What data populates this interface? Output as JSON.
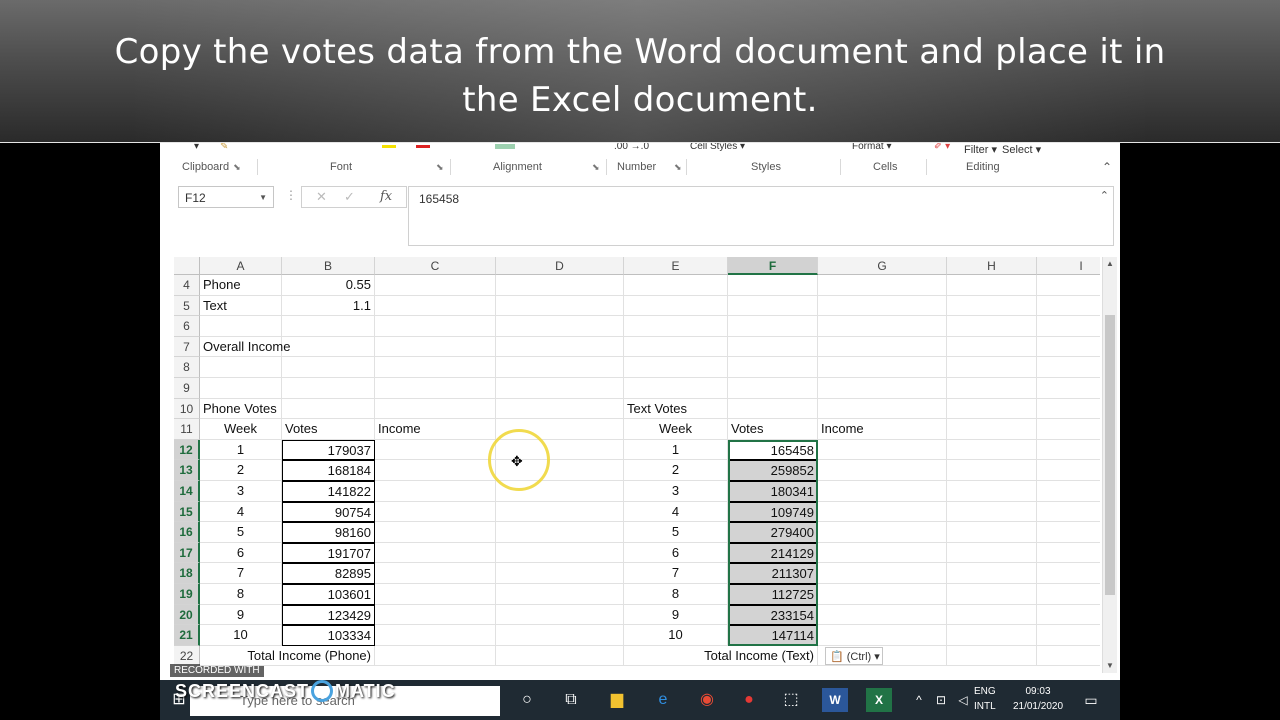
{
  "caption": {
    "line1": "Copy the votes data from the Word document and place it in",
    "line2": "the Excel document."
  },
  "ribbon": {
    "top_items": {
      "number_format": ".00 →.0",
      "cell_styles": "Cell Styles ▾",
      "format": "Format ▾",
      "filter": "Filter ▾",
      "select": "Select ▾"
    },
    "groups": [
      "Clipboard",
      "Font",
      "Alignment",
      "Number",
      "Styles",
      "Cells",
      "Editing"
    ]
  },
  "formula": {
    "namebox": "F12",
    "value": "165458"
  },
  "columns": [
    "A",
    "B",
    "C",
    "D",
    "E",
    "F",
    "G",
    "H",
    "I"
  ],
  "selected_column": "F",
  "rows": {
    "r4": {
      "num": "4",
      "a": "Phone",
      "b": "0.55"
    },
    "r5": {
      "num": "5",
      "a": "Text",
      "b": "1.1"
    },
    "r6": {
      "num": "6"
    },
    "r7": {
      "num": "7",
      "a": "Overall Income"
    },
    "r8": {
      "num": "8"
    },
    "r9": {
      "num": "9"
    },
    "r10": {
      "num": "10",
      "a": "Phone Votes",
      "e": "Text Votes"
    },
    "r11": {
      "num": "11",
      "a": "Week",
      "b": "Votes",
      "c": "Income",
      "e": "Week",
      "f": "Votes",
      "g": "Income"
    },
    "r22": {
      "num": "22",
      "ab": "Total Income (Phone)",
      "ef": "Total Income (Text)"
    }
  },
  "phone_votes": [
    {
      "row": "12",
      "week": "1",
      "votes": "179037"
    },
    {
      "row": "13",
      "week": "2",
      "votes": "168184"
    },
    {
      "row": "14",
      "week": "3",
      "votes": "141822"
    },
    {
      "row": "15",
      "week": "4",
      "votes": "90754"
    },
    {
      "row": "16",
      "week": "5",
      "votes": "98160"
    },
    {
      "row": "17",
      "week": "6",
      "votes": "191707"
    },
    {
      "row": "18",
      "week": "7",
      "votes": "82895"
    },
    {
      "row": "19",
      "week": "8",
      "votes": "103601"
    },
    {
      "row": "20",
      "week": "9",
      "votes": "123429"
    },
    {
      "row": "21",
      "week": "10",
      "votes": "103334"
    }
  ],
  "text_votes": [
    {
      "week": "1",
      "votes": "165458"
    },
    {
      "week": "2",
      "votes": "259852"
    },
    {
      "week": "3",
      "votes": "180341"
    },
    {
      "week": "4",
      "votes": "109749"
    },
    {
      "week": "5",
      "votes": "279400"
    },
    {
      "week": "6",
      "votes": "214129"
    },
    {
      "week": "7",
      "votes": "211307"
    },
    {
      "week": "8",
      "votes": "112725"
    },
    {
      "week": "9",
      "votes": "233154"
    },
    {
      "week": "10",
      "votes": "147114"
    }
  ],
  "paste_options": "(Ctrl) ▾",
  "taskbar": {
    "search_placeholder": "Type here to search",
    "lang": "ENG",
    "layout": "INTL",
    "time": "09:03",
    "date": "21/01/2020"
  },
  "watermark": {
    "recorded": "RECORDED WITH",
    "brand_left": "SCREENCAST",
    "brand_right": "MATIC"
  },
  "colors": {
    "excel_green": "#217346",
    "selection_fill": "#d3d3d3",
    "cursor_highlight": "#f0d73c"
  }
}
